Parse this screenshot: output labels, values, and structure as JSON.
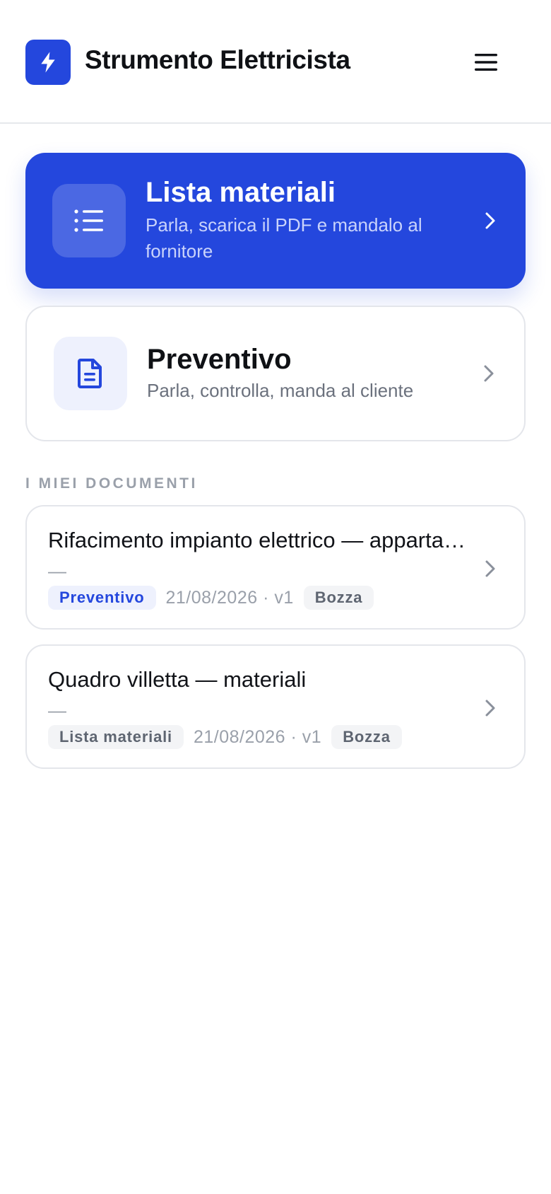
{
  "header": {
    "title": "Strumento Elettricista",
    "logo_icon": "lightning-bolt-icon",
    "menu_icon": "hamburger-menu-icon"
  },
  "actions": [
    {
      "title": "Lista materiali",
      "subtitle": "Parla, scarica il PDF e mandalo al fornitore",
      "icon": "list-icon"
    },
    {
      "title": "Preventivo",
      "subtitle": "Parla, controlla, manda al cliente",
      "icon": "document-icon"
    }
  ],
  "documents": {
    "section_label": "I MIEI DOCUMENTI",
    "items": [
      {
        "title": "Rifacimento impianto elettrico — appartamento",
        "subtitle": "—",
        "type": "Preventivo",
        "date_version": "21/08/2026 · v1",
        "status": "Bozza"
      },
      {
        "title": "Quadro villetta — materiali",
        "subtitle": "—",
        "type": "Lista materiali",
        "date_version": "21/08/2026 · v1",
        "status": "Bozza"
      }
    ]
  },
  "colors": {
    "accent": "#2447dd",
    "background": "#ffffff",
    "muted_text": "#9aa0aa",
    "border": "#e4e6eb"
  }
}
